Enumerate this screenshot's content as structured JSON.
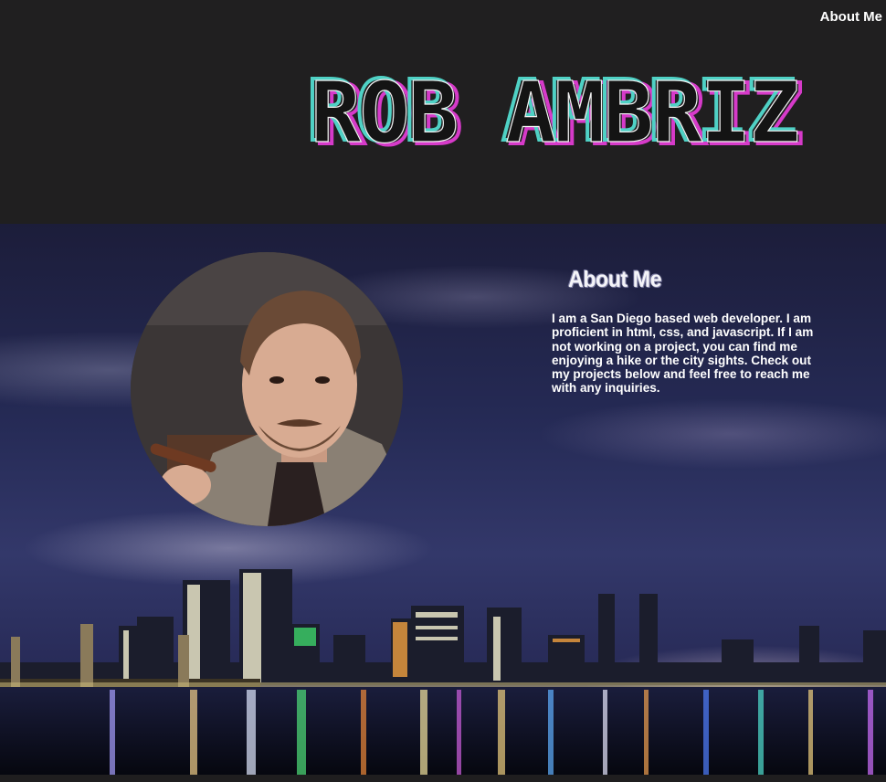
{
  "nav": {
    "about_label": "About Me"
  },
  "header": {
    "logo_text": "ROB AMBRIZ"
  },
  "about": {
    "heading": "About Me",
    "body": "I am a San Diego based web developer. I am proficient in html, css, and javascript. If I am not working on a project, you can find me enjoying a hike or the city sights. Check out my projects below and feel free to reach me with any inquiries."
  },
  "colors": {
    "header_bg": "#201f20",
    "logo_cyan": "#4fd1c5",
    "logo_magenta": "#d63ac9",
    "logo_fill": "#141414"
  }
}
